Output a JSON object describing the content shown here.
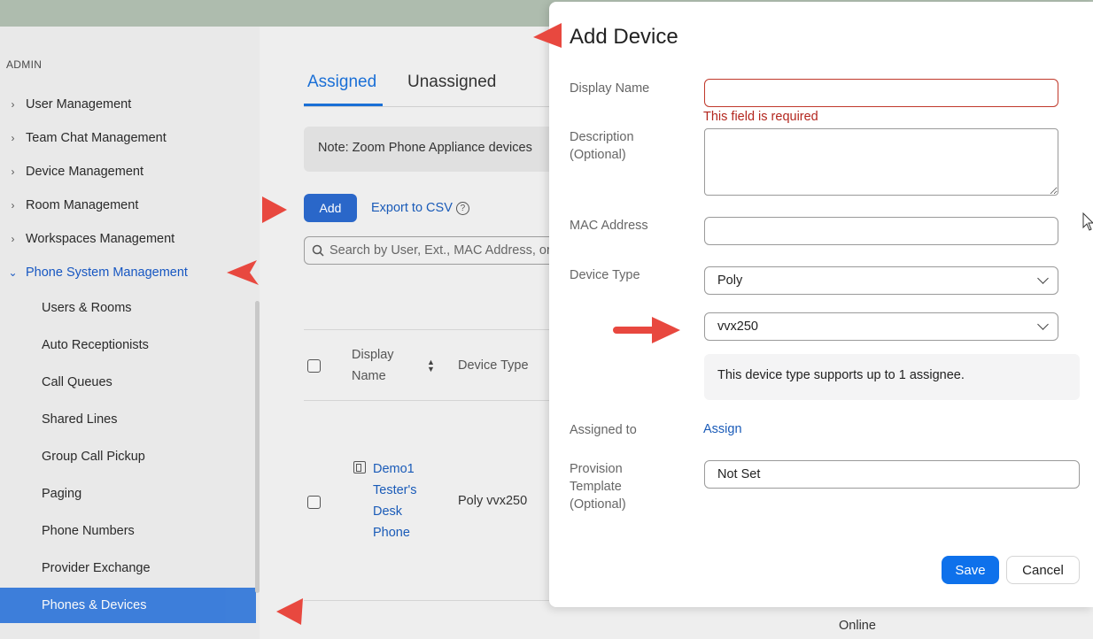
{
  "sidebar": {
    "section_label": "ADMIN",
    "items": [
      {
        "label": "User Management"
      },
      {
        "label": "Team Chat Management"
      },
      {
        "label": "Device Management"
      },
      {
        "label": "Room Management"
      },
      {
        "label": "Workspaces Management"
      },
      {
        "label": "Phone System Management"
      }
    ],
    "sub_items": [
      {
        "label": "Users & Rooms"
      },
      {
        "label": "Auto Receptionists"
      },
      {
        "label": "Call Queues"
      },
      {
        "label": "Shared Lines"
      },
      {
        "label": "Group Call Pickup"
      },
      {
        "label": "Paging"
      },
      {
        "label": "Phone Numbers"
      },
      {
        "label": "Provider Exchange"
      },
      {
        "label": "Phones & Devices"
      }
    ]
  },
  "main": {
    "tabs": [
      {
        "label": "Assigned"
      },
      {
        "label": "Unassigned"
      }
    ],
    "note": "Note: Zoom Phone Appliance devices",
    "add_label": "Add",
    "export_label": "Export to CSV",
    "help_glyph": "?",
    "search_placeholder": "Search by User, Ext., MAC Address, or",
    "table": {
      "headers": {
        "display_name": "Display Name",
        "device_type": "Device Type"
      },
      "row": {
        "display_name": "Demo1 Tester's Desk Phone",
        "device_type": "Poly vvx250"
      }
    },
    "status": "Online"
  },
  "modal": {
    "title": "Add Device",
    "display_name_label": "Display Name",
    "display_name_value": "",
    "display_name_error": "This field is required",
    "description_label": "Description (Optional)",
    "mac_label": "MAC Address",
    "mac_value": "",
    "device_type_label": "Device Type",
    "device_brand": "Poly",
    "device_model": "vvx250",
    "info_text": "This device type supports up to 1 assignee.",
    "assigned_label": "Assigned to",
    "assign_link": "Assign",
    "template_label": "Provision Template (Optional)",
    "template_value": "Not Set",
    "save_label": "Save",
    "cancel_label": "Cancel"
  },
  "colors": {
    "accent": "#0e71eb",
    "error": "#b3261e",
    "annotation_arrow": "#e8483f"
  }
}
